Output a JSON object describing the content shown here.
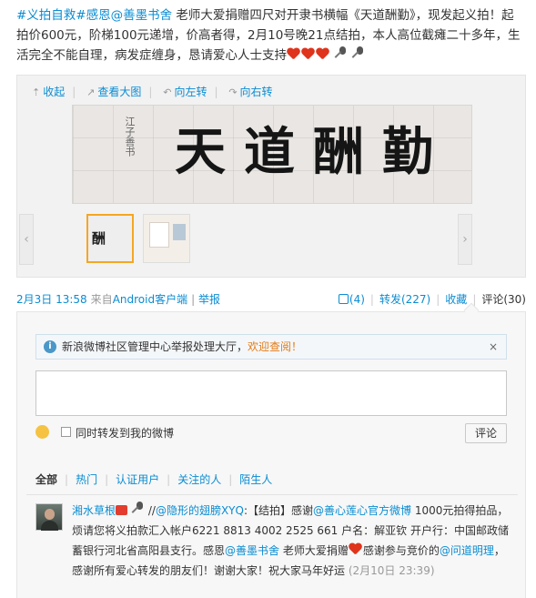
{
  "post": {
    "tag1": "#义拍自救#",
    "tag2": "感恩",
    "mention": "@善墨书舍",
    "body": " 老师大爱捐赠四尺对开隶书横幅《天道酬勤》，现发起义拍！起拍价600元，阶梯100元递增，价高者得，2月10号晚21点结拍，本人高位截瘫二十多年，生活完全不能自理，病发症缠身，恳请爱心人士支持",
    "emotes": [
      "heart",
      "heart",
      "heart",
      "microphone",
      "microphone"
    ]
  },
  "media": {
    "toolbar": {
      "collapse": "收起",
      "view_large": "查看大图",
      "rotate_left": "向左转",
      "rotate_right": "向右转"
    },
    "calligraphy": "天道酬勤",
    "thumb1_text": "酬"
  },
  "meta": {
    "date": "2月3日 13:58",
    "from_prefix": "来自",
    "from_app": "Android客户端",
    "report": "举报",
    "like": "(4)",
    "repost": "转发(227)",
    "favorite": "收藏",
    "comment": "评论(30)"
  },
  "comment_panel": {
    "notice_text": "新浪微博社区管理中心举报处理大厅，",
    "notice_link": "欢迎查阅！",
    "notice_close": "×",
    "repost_checkbox_label": "同时转发到我的微博",
    "submit": "评论",
    "tabs": [
      "全部",
      "热门",
      "认证用户",
      "关注的人",
      "陌生人"
    ],
    "comment": {
      "user": "湘水草根",
      "prefix": "//",
      "mention1": "@隐形的翅膀XYQ",
      "text1": ":【结拍】感谢",
      "mention2": "@善心莲心官方微博",
      "text2": " 1000元拍得拍品，烦请您将义拍款汇入帐户6221 8813 4002 2525 661 户名：解亚钦 开户行：中国邮政储蓄银行河北省高阳县支行。感恩",
      "mention3": "@善墨书舍",
      "text3": " 老师大爱捐赠",
      "text4": "感谢参与竞价的",
      "mention4": "@问道明理",
      "text5": "，感谢所有爱心转发的朋友们！谢谢大家！祝大家马年好运",
      "time": "(2月10日 23:39)"
    }
  },
  "colors": {
    "link": "#0a8cd2",
    "heart": "#e0331c",
    "notice_highlight": "#e47b14"
  }
}
